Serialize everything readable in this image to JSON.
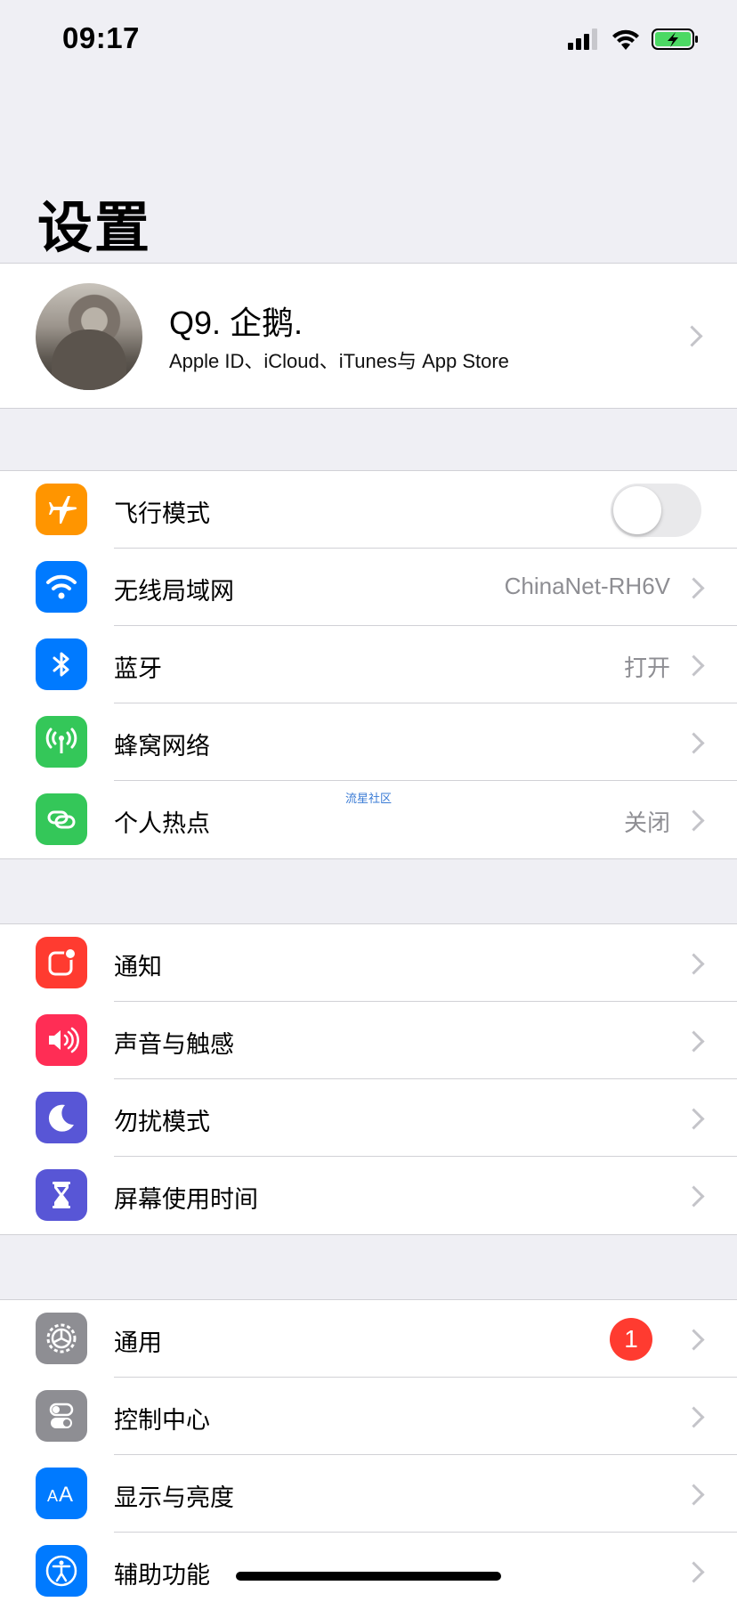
{
  "status_bar": {
    "time": "09:17"
  },
  "title": "设置",
  "profile": {
    "name": "Q9.  企鹅.",
    "subtitle": "Apple ID、iCloud、iTunes与 App Store"
  },
  "groups": [
    {
      "rows": [
        {
          "label": "飞行模式",
          "icon": "airplane-icon",
          "color": "#ff9500",
          "toggle": false
        },
        {
          "label": "无线局域网",
          "icon": "wifi-icon",
          "color": "#007aff",
          "value": "ChinaNet-RH6V"
        },
        {
          "label": "蓝牙",
          "icon": "bluetooth-icon",
          "color": "#007aff",
          "value": "打开"
        },
        {
          "label": "蜂窝网络",
          "icon": "cellular-icon",
          "color": "#34c759"
        },
        {
          "label": "个人热点",
          "icon": "hotspot-icon",
          "color": "#34c759",
          "value": "关闭"
        }
      ]
    },
    {
      "rows": [
        {
          "label": "通知",
          "icon": "notifications-icon",
          "color": "#ff3b30"
        },
        {
          "label": "声音与触感",
          "icon": "sound-icon",
          "color": "#ff2d55"
        },
        {
          "label": "勿扰模式",
          "icon": "moon-icon",
          "color": "#5856d6"
        },
        {
          "label": "屏幕使用时间",
          "icon": "hourglass-icon",
          "color": "#5856d6"
        }
      ]
    },
    {
      "rows": [
        {
          "label": "通用",
          "icon": "gear-icon",
          "color": "#8e8e93",
          "badge": "1"
        },
        {
          "label": "控制中心",
          "icon": "control-center-icon",
          "color": "#8e8e93"
        },
        {
          "label": "显示与亮度",
          "icon": "display-icon",
          "color": "#007aff"
        },
        {
          "label": "辅助功能",
          "icon": "accessibility-icon",
          "color": "#007aff"
        }
      ]
    }
  ],
  "watermark": "流星社区"
}
